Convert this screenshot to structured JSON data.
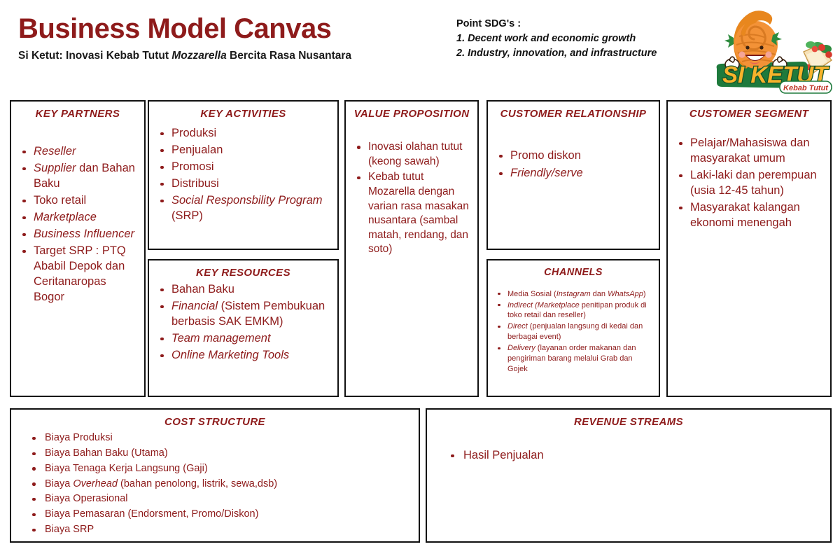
{
  "header": {
    "title": "Business Model Canvas",
    "subtitle_prefix": "Si Ketut: Inovasi Kebab Tutut ",
    "subtitle_italic": "Mozzarella",
    "subtitle_suffix": " Bercita Rasa Nusantara",
    "sdg_heading": "Point SDG's :",
    "sdg_items": [
      "1. Decent work and economic growth",
      "2. Industry, innovation, and infrastructure"
    ]
  },
  "logo": {
    "brand": "SI KETUT",
    "tagline": "Kebab Tutut",
    "mascot": "snail-shell-mascot",
    "colors": {
      "shell": "#F39237",
      "shell_dark": "#D97A22",
      "banner_green": "#1E7A3C",
      "brand_text": "#F7B32B",
      "tagline_text": "#C0392B"
    }
  },
  "colors": {
    "accent": "#8e1b1b",
    "border": "#111111",
    "text_dark": "#1a1a1a",
    "background": "#ffffff"
  },
  "blocks": {
    "key_partners": {
      "title": "KEY PARTNERS",
      "items": [
        [
          {
            "t": "Reseller",
            "i": true
          }
        ],
        [
          {
            "t": "Supplier",
            "i": true
          },
          {
            "t": " dan Bahan Baku",
            "i": false
          }
        ],
        [
          {
            "t": "Toko retail",
            "i": false
          }
        ],
        [
          {
            "t": "Marketplace",
            "i": true
          }
        ],
        [
          {
            "t": "Business Influencer",
            "i": true
          }
        ],
        [
          {
            "t": "Target SRP : PTQ Ababil Depok dan Ceritanaropas Bogor",
            "i": false
          }
        ]
      ]
    },
    "key_activities": {
      "title": "KEY ACTIVITIES",
      "items": [
        [
          {
            "t": "Produksi",
            "i": false
          }
        ],
        [
          {
            "t": "Penjualan",
            "i": false
          }
        ],
        [
          {
            "t": "Promosi",
            "i": false
          }
        ],
        [
          {
            "t": "Distribusi",
            "i": false
          }
        ],
        [
          {
            "t": "Social Responsbility Program",
            "i": true
          },
          {
            "t": " (SRP)",
            "i": false
          }
        ]
      ]
    },
    "key_resources": {
      "title": "KEY RESOURCES",
      "items": [
        [
          {
            "t": "Bahan Baku",
            "i": false
          }
        ],
        [
          {
            "t": "Financial",
            "i": true
          },
          {
            "t": " (Sistem Pembukuan berbasis SAK EMKM)",
            "i": false
          }
        ],
        [
          {
            "t": "Team management",
            "i": true
          }
        ],
        [
          {
            "t": "Online Marketing Tools",
            "i": true
          }
        ]
      ]
    },
    "value_proposition": {
      "title": "VALUE PROPOSITION",
      "items": [
        [
          {
            "t": "Inovasi olahan tutut (keong sawah)",
            "i": false
          }
        ],
        [
          {
            "t": "Kebab tutut Mozarella dengan varian rasa masakan nusantara (sambal matah, rendang, dan soto)",
            "i": false
          }
        ]
      ]
    },
    "customer_relationship": {
      "title": "CUSTOMER RELATIONSHIP",
      "items": [
        [
          {
            "t": "Promo diskon",
            "i": false
          }
        ],
        [
          {
            "t": "Friendly/serve",
            "i": true
          }
        ]
      ]
    },
    "channels": {
      "title": "CHANNELS",
      "items": [
        [
          {
            "t": "Media Sosial (",
            "i": false
          },
          {
            "t": "Instagram",
            "i": true
          },
          {
            "t": " dan ",
            "i": false
          },
          {
            "t": "WhatsApp",
            "i": true
          },
          {
            "t": ")",
            "i": false
          }
        ],
        [
          {
            "t": "Indirect (Marketplace",
            "i": true
          },
          {
            "t": " penitipan produk di toko retail dan reseller)",
            "i": false
          }
        ],
        [
          {
            "t": "Direct",
            "i": true
          },
          {
            "t": " (penjualan langsung di kedai dan berbagai event)",
            "i": false
          }
        ],
        [
          {
            "t": "Delivery",
            "i": true
          },
          {
            "t": " (layanan order makanan dan pengiriman barang melalui Grab dan Gojek",
            "i": false
          }
        ]
      ]
    },
    "customer_segment": {
      "title": "CUSTOMER SEGMENT",
      "items": [
        [
          {
            "t": "Pelajar/Mahasiswa dan masyarakat umum",
            "i": false
          }
        ],
        [
          {
            "t": "Laki-laki dan perempuan (usia 12-45 tahun)",
            "i": false
          }
        ],
        [
          {
            "t": "Masyarakat kalangan ekonomi menengah",
            "i": false
          }
        ]
      ]
    },
    "cost_structure": {
      "title": "COST STRUCTURE",
      "items": [
        [
          {
            "t": "Biaya Produksi",
            "i": false
          }
        ],
        [
          {
            "t": "Biaya Bahan Baku (Utama)",
            "i": false
          }
        ],
        [
          {
            "t": "Biaya Tenaga Kerja Langsung (Gaji)",
            "i": false
          }
        ],
        [
          {
            "t": "Biaya ",
            "i": false
          },
          {
            "t": "Overhead",
            "i": true
          },
          {
            "t": " (bahan penolong, listrik, sewa,dsb)",
            "i": false
          }
        ],
        [
          {
            "t": "Biaya Operasional",
            "i": false
          }
        ],
        [
          {
            "t": "Biaya Pemasaran (Endorsment, Promo/Diskon)",
            "i": false
          }
        ],
        [
          {
            "t": "Biaya SRP",
            "i": false
          }
        ]
      ]
    },
    "revenue_streams": {
      "title": "REVENUE STREAMS",
      "items": [
        [
          {
            "t": "Hasil Penjualan",
            "i": false
          }
        ]
      ]
    }
  }
}
